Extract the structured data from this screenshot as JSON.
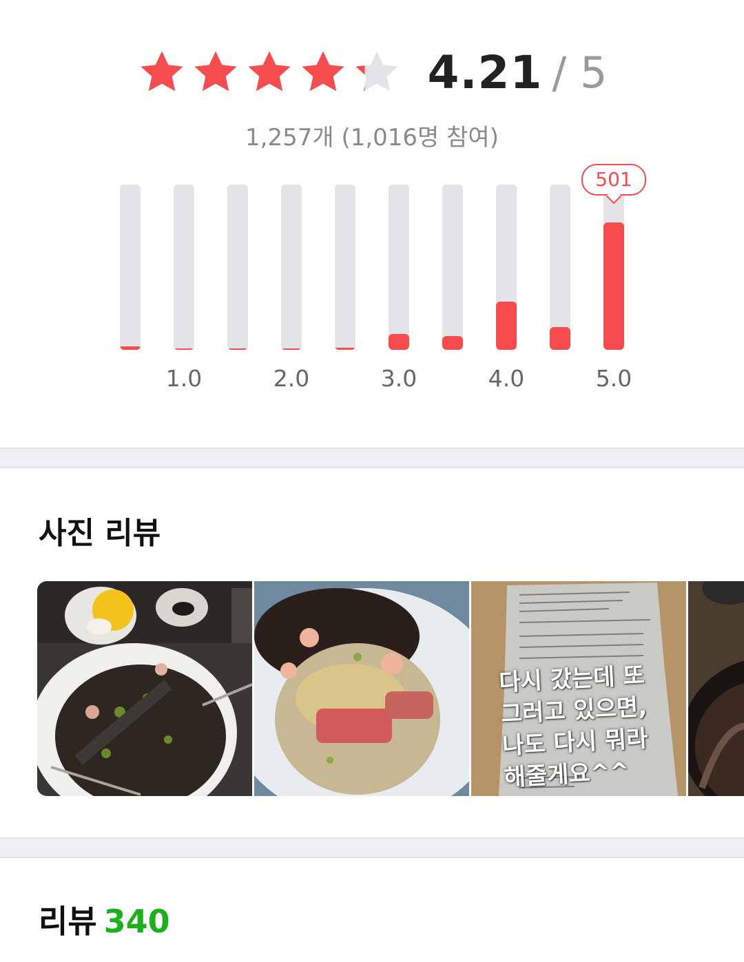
{
  "rating": {
    "score": "4.21",
    "max": "/ 5",
    "score_value": 4.21,
    "star_count": 5,
    "count_text": "1,257개 (1,016명 참여)",
    "colors": {
      "accent": "#f74b4e",
      "star_empty": "#e2e4e8",
      "track": "#e2e4e8"
    }
  },
  "chart_data": {
    "type": "bar",
    "categories": [
      "0.5",
      "1.0",
      "1.5",
      "2.0",
      "2.5",
      "3.0",
      "3.5",
      "4.0",
      "4.5",
      "5.0"
    ],
    "tick_labels": [
      "1.0",
      "2.0",
      "3.0",
      "4.0",
      "5.0"
    ],
    "values": [
      14,
      4,
      2,
      6,
      9,
      63,
      55,
      190,
      89,
      501
    ],
    "ylim": [
      0,
      650
    ],
    "highlight": {
      "category": "5.0",
      "label": "501"
    },
    "grid": false
  },
  "photo_reviews": {
    "title": "사진 리뷰",
    "overlay_text": [
      "다시 갔는데 또",
      "그러고 있으면,",
      "나도 다시 뭐라",
      "해줄게요^^"
    ]
  },
  "reviews": {
    "label": "리뷰",
    "count": "340",
    "count_color": "#1db01d"
  }
}
